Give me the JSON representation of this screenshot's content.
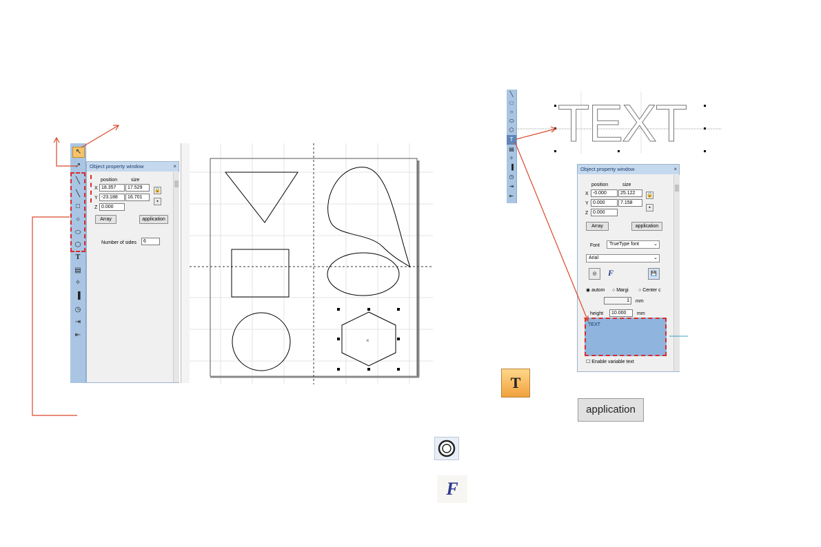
{
  "left_panel": {
    "title": "Object property window",
    "close": "×",
    "position_label": "position",
    "size_label": "size",
    "x_label": "X",
    "y_label": "Y",
    "z_label": "Z",
    "x_pos": "18.357",
    "y_pos": "-23.188",
    "z_pos": "0.000",
    "x_size": "17.529",
    "y_size": "16.701",
    "array_btn": "Array",
    "application_btn": "application",
    "sides_label": "Number of sides",
    "sides_value": "6"
  },
  "right_panel": {
    "title": "Object property window",
    "close": "×",
    "position_label": "position",
    "size_label": "size",
    "x_label": "X",
    "y_label": "Y",
    "z_label": "Z",
    "x_pos": "-0.000",
    "y_pos": "0.000",
    "z_pos": "0.000",
    "x_size": "25.122",
    "y_size": "7.158",
    "array_btn": "Array",
    "application_btn": "application",
    "font_label": "Font",
    "font_type": "TrueType font",
    "font_name": "Arial",
    "radio_auto": "autom",
    "radio_margin": "Margi",
    "radio_center": "Center c",
    "spacing_value": "1",
    "mm1": "mm",
    "height_label": "height",
    "height_value": "10.000",
    "mm2": "mm",
    "text_content": "TEXT",
    "enable_variable": "Enable variable text"
  },
  "canvas_text": "TEXT",
  "icons": {
    "text_tool_glyph": "T",
    "application_button": "application",
    "f_glyph": "F"
  },
  "colors": {
    "arrow": "#d9472b",
    "dashed_box": "#d92a2a",
    "toolbar": "#a9c5e3",
    "teal": "#3aa0c8"
  }
}
